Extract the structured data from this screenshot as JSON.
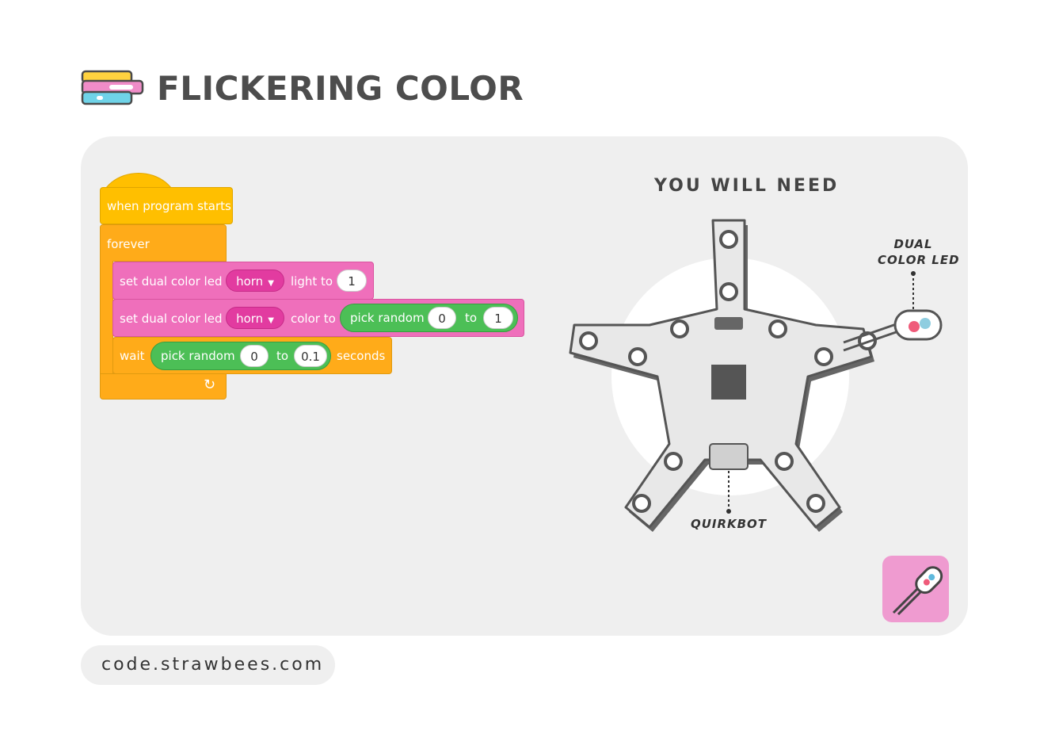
{
  "header": {
    "title": "FLICKERING COLOR"
  },
  "code": {
    "hat": "when program starts",
    "forever": "forever",
    "set_light": {
      "label": "set dual color led",
      "dropdown": "horn",
      "mid": "light to",
      "value": "1"
    },
    "set_color": {
      "label": "set dual color led",
      "dropdown": "horn",
      "mid": "color to",
      "random": "pick random",
      "from": "0",
      "to_label": "to",
      "to": "1"
    },
    "wait": {
      "label": "wait",
      "random": "pick random",
      "from": "0",
      "to_label": "to",
      "to": "0.1",
      "suffix": "seconds"
    }
  },
  "parts": {
    "heading": "YOU WILL NEED",
    "led_label_1": "DUAL",
    "led_label_2": "COLOR LED",
    "board_label": "QUIRKBOT"
  },
  "footer": {
    "url": "code.strawbees.com"
  },
  "colors": {
    "hat": "#ffbf00",
    "control": "#ffab19",
    "led_block": "#ef6fbb",
    "operator": "#4cbf56",
    "badge": "#ef9bd0",
    "card": "#efefef"
  },
  "icons": [
    "blocks-logo-icon",
    "loop-arrow-icon",
    "dropdown-caret-icon",
    "dual-color-led-icon",
    "quirkbot-board-icon"
  ]
}
